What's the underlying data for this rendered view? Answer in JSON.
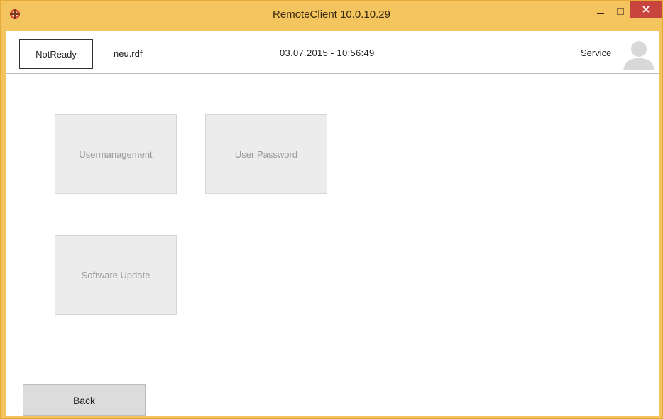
{
  "window": {
    "title": "RemoteClient 10.0.10.29",
    "frame_color": "#f4c45e",
    "close_color": "#c7453c"
  },
  "header": {
    "status": "NotReady",
    "filename": "neu.rdf",
    "datetime": "03.07.2015  -  10:56:49",
    "user_role": "Service"
  },
  "tiles": [
    {
      "label": "Usermanagement"
    },
    {
      "label": "User Password"
    },
    {
      "label": "Software Update"
    }
  ],
  "footer": {
    "back_label": "Back"
  },
  "icons": {
    "app": "app-icon",
    "minimize": "minimize-icon",
    "maximize": "maximize-icon",
    "close": "close-icon",
    "user": "user-avatar-icon"
  }
}
